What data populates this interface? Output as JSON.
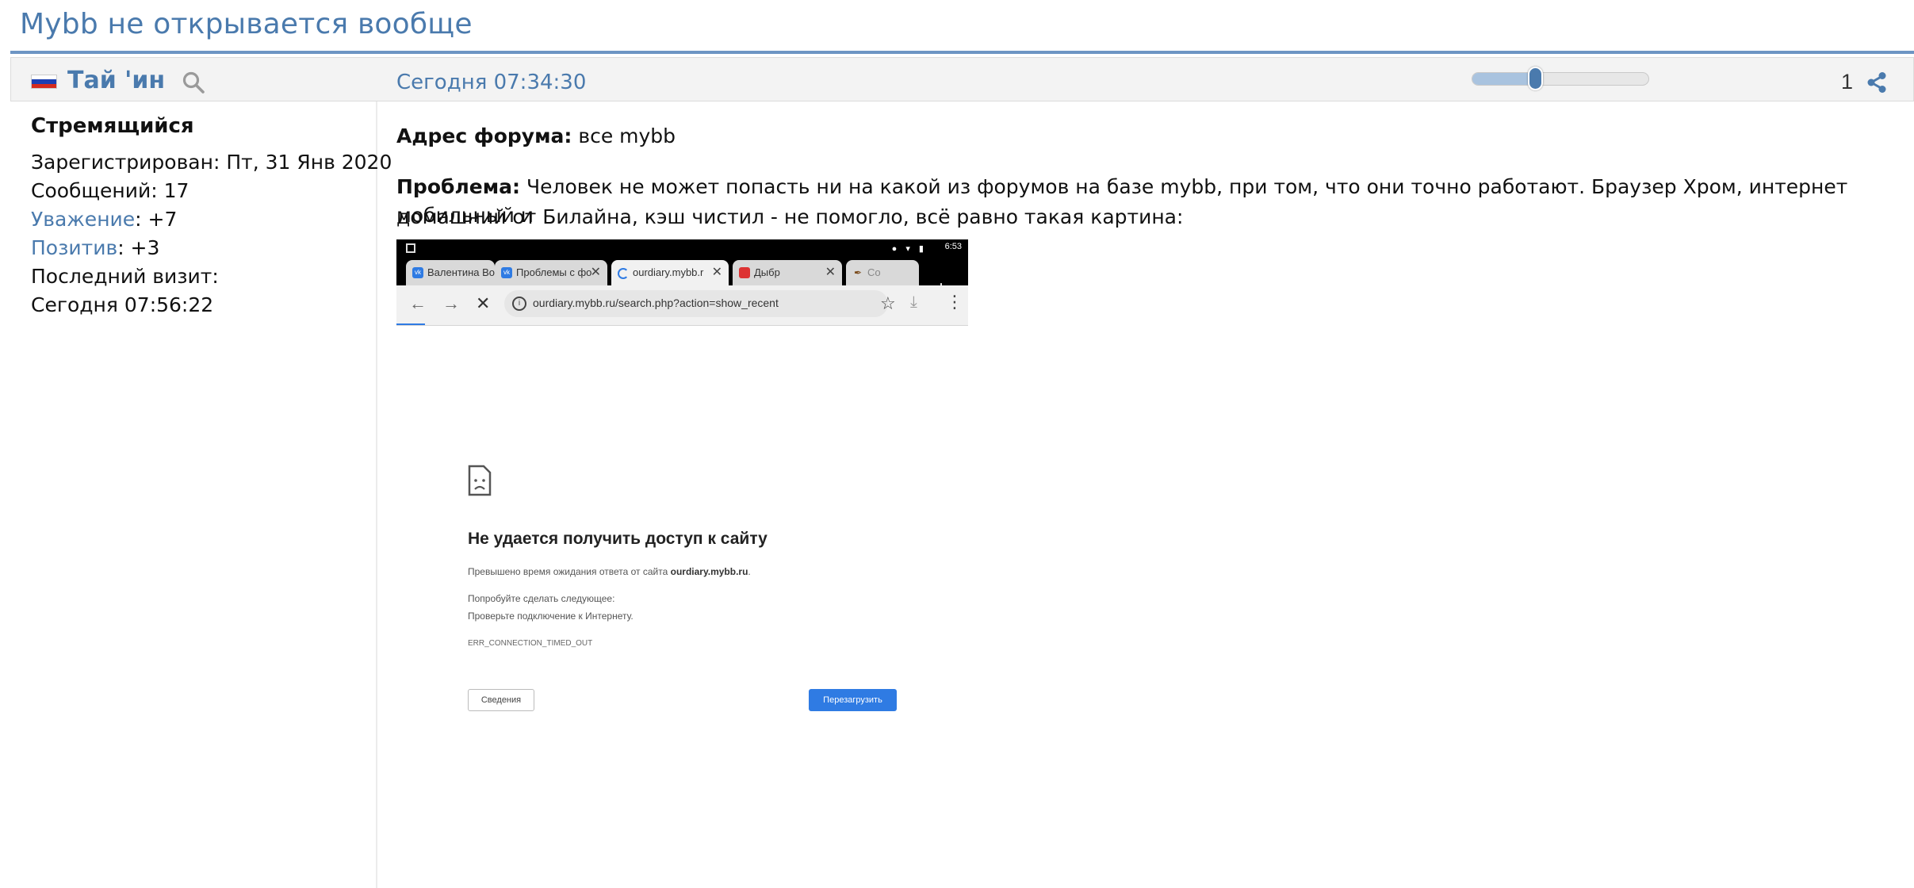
{
  "topic": {
    "title": "Mybb не открывается вообще"
  },
  "post": {
    "author": "Тай 'ин",
    "time": "Сегодня 07:34:30",
    "number": "1",
    "slider_level": 0.36
  },
  "author_info": {
    "rank": "Стремящийся",
    "registered": "Зарегистрирован: Пт, 31 Янв 2020",
    "messages": "Сообщений: 17",
    "respect_label": "Уважение",
    "respect_value": ": +7",
    "positive_label": "Позитив",
    "positive_value": ": +3",
    "last_visit_label": "Последний визит:",
    "last_visit_value": "Сегодня 07:56:22"
  },
  "content": {
    "forum_label": "Адрес форума:",
    "forum_value": " все mybb",
    "problem_label": "Проблема:",
    "problem_line1": " Человек не может попасть ни на какой из форумов на базе mybb, при том, что они точно работают. Браузер Хром, интернет мобильный и",
    "problem_line2": "домашний от Билайна, кэш чистил - не помогло, всё равно такая картина:"
  },
  "screenshot": {
    "status_time": "6:53",
    "tabs": [
      {
        "label": "Валентина Во",
        "icon": "vk-icon"
      },
      {
        "label": "Проблемы с фо",
        "icon": "vk-icon"
      },
      {
        "label": "ourdiary.mybb.r",
        "icon": "loading-icon"
      },
      {
        "label": "Дыбр",
        "icon": "bookmark-icon"
      },
      {
        "label": "Co",
        "icon": "feather-icon"
      }
    ],
    "url": "ourdiary.mybb.ru/search.php?action=show_recent",
    "error_title": "Не удается получить доступ к сайту",
    "error_timeout_prefix": "Превышено время ожидания ответа от сайта ",
    "error_host": "ourdiary.mybb.ru",
    "error_timeout_suffix": ".",
    "try_label": "Попробуйте сделать следующее:",
    "try_item": "Проверьте подключение к Интернету.",
    "error_code": "ERR_CONNECTION_TIMED_OUT",
    "details_button": "Сведения",
    "reload_button": "Перезагрузить"
  },
  "colors": {
    "accent": "#4a7aad",
    "header_bg": "#f3f3f3",
    "chrome_blue": "#2f7be3"
  }
}
